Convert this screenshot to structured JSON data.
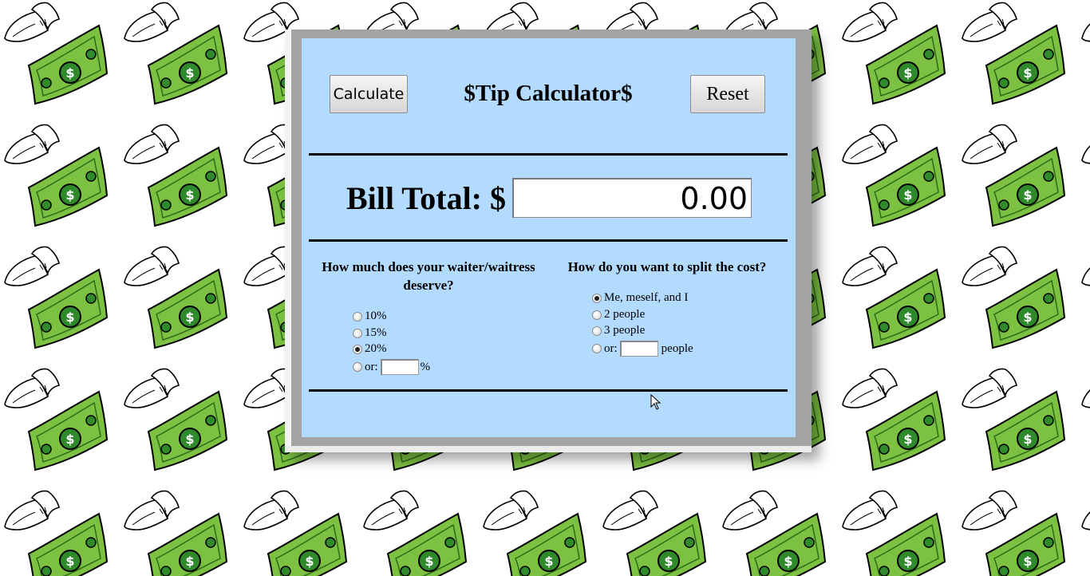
{
  "app": {
    "title": "$Tip Calculator$"
  },
  "toolbar": {
    "calculate_label": "Calculate",
    "reset_label": "Reset"
  },
  "bill": {
    "label": "Bill Total: $",
    "value": "0.00"
  },
  "tip": {
    "heading": "How much does your waiter/waitress deserve?",
    "options": [
      {
        "label": "10%",
        "checked": false
      },
      {
        "label": "15%",
        "checked": false
      },
      {
        "label": "20%",
        "checked": true
      },
      {
        "label": "or:",
        "checked": false,
        "custom": true,
        "suffix": "%"
      }
    ]
  },
  "split": {
    "heading": "How do you want to split the cost?",
    "options": [
      {
        "label": "Me, meself, and I",
        "checked": true
      },
      {
        "label": "2 people",
        "checked": false
      },
      {
        "label": "3 people",
        "checked": false
      },
      {
        "label": "or:",
        "checked": false,
        "custom": true,
        "suffix": "people"
      }
    ]
  },
  "colors": {
    "panel": "#b3daff",
    "frame": "#a3a3a3",
    "bill_green": "#7cc142",
    "bill_dark": "#0f5a1c"
  },
  "icons": {
    "background_tile": "flying-money-icon"
  }
}
